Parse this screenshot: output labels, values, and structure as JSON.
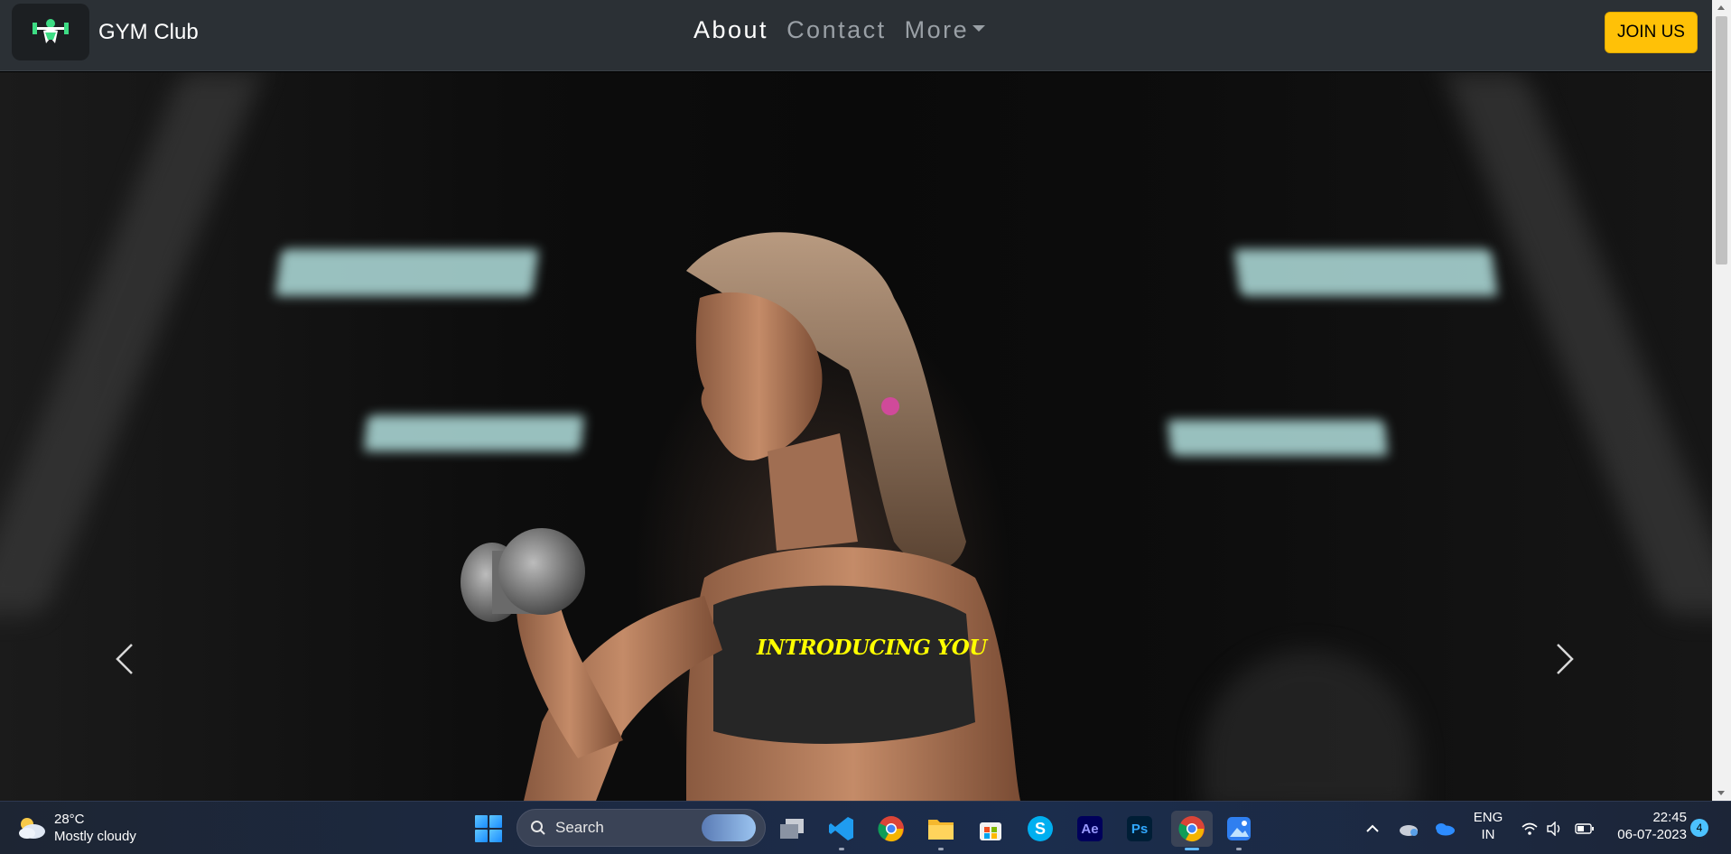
{
  "navbar": {
    "brand": "GYM Club",
    "logo_icon": "dumbbell-lifter-icon",
    "links": [
      {
        "label": "About",
        "active": true
      },
      {
        "label": "Contact",
        "active": false
      },
      {
        "label": "More",
        "active": false,
        "dropdown": true
      }
    ],
    "cta_label": "JOIN US",
    "cta_color": "#ffc107"
  },
  "carousel": {
    "caption": "INTRODUCING YOU",
    "caption_color": "#ffff00",
    "prev_icon": "chevron-left-icon",
    "next_icon": "chevron-right-icon"
  },
  "taskbar": {
    "weather": {
      "temp": "28°C",
      "condition": "Mostly cloudy",
      "icon": "cloudy-icon"
    },
    "search_label": "Search",
    "apps": [
      "task-view",
      "vs-code",
      "chrome",
      "file-explorer",
      "microsoft-store",
      "skype",
      "after-effects",
      "photoshop",
      "chrome-active",
      "photos"
    ],
    "ae_label": "Ae",
    "ps_label": "Ps",
    "skype_label": "S",
    "language": {
      "line1": "ENG",
      "line2": "IN"
    },
    "clock": {
      "time": "22:45",
      "date": "06-07-2023"
    },
    "notification_count": "4"
  }
}
